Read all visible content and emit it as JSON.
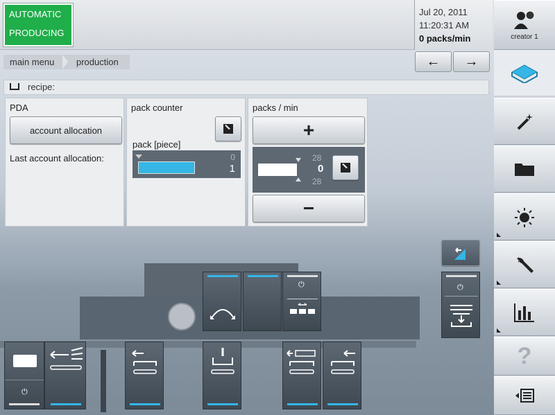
{
  "status": {
    "line1": "AUTOMATIC",
    "line2": "PRODUCING"
  },
  "header": {
    "date": "Jul 20, 2011",
    "time": "11:20:31 AM",
    "rate": "0 packs/min"
  },
  "user": {
    "name": "creator 1"
  },
  "breadcrumb": [
    "main menu",
    "production"
  ],
  "recipe": {
    "label": "recipe:"
  },
  "pda": {
    "title": "PDA",
    "button": "account allocation",
    "last_label": "Last account allocation:"
  },
  "pack_counter": {
    "title": "pack counter",
    "field_label": "pack [piece]",
    "max": "0",
    "value": "1",
    "fill_fraction": 1.0
  },
  "packs_min": {
    "title": "packs / min",
    "upper": "28",
    "value": "0",
    "lower": "28",
    "plus": "+",
    "minus": "−"
  },
  "colors": {
    "status_green": "#1fae4a",
    "accent_cyan": "#35b6e6"
  },
  "sidebar": [
    "user-icon",
    "conveyor-icon",
    "magic-wand-icon",
    "folder-icon",
    "brightness-icon",
    "wrench-icon",
    "bar-chart-icon",
    "help-icon",
    "list-icon"
  ],
  "machine": {
    "power_symbol": "⏻"
  }
}
